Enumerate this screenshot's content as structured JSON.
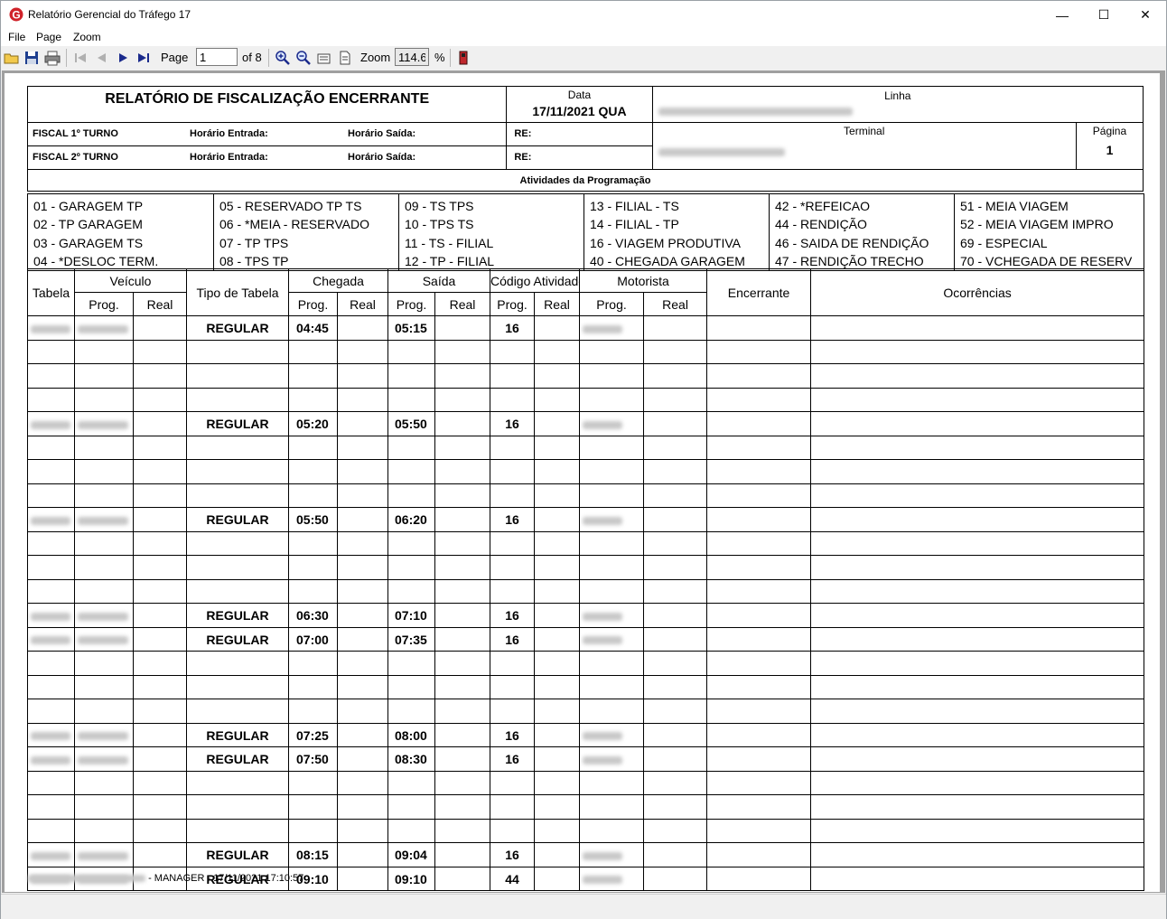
{
  "window": {
    "title": "Relatório Gerencial do Tráfego 17",
    "minimize": "—",
    "maximize": "☐",
    "close": "✕"
  },
  "menu": {
    "file": "File",
    "page": "Page",
    "zoom": "Zoom"
  },
  "toolbar": {
    "page_label": "Page",
    "page_value": "1",
    "of_pages": "of 8",
    "zoom_label": "Zoom",
    "zoom_value": "114.6",
    "percent": "%"
  },
  "report": {
    "title": "RELATÓRIO DE FISCALIZAÇÃO ENCERRANTE",
    "data_label": "Data",
    "data_value": "17/11/2021  QUA",
    "linha_label": "Linha",
    "terminal_label": "Terminal",
    "pagina_label": "Página",
    "pagina_value": "1",
    "fiscal1": "FISCAL 1º TURNO",
    "fiscal2": "FISCAL 2º TURNO",
    "horario_entrada": "Horário Entrada:",
    "horario_saida": "Horário Saída:",
    "re": "RE:",
    "atividades_title": "Atividades  da  Programação",
    "activities": [
      [
        "01 - GARAGEM TP",
        "02 - TP GARAGEM",
        "03 - GARAGEM TS",
        "04 - *DESLOC TERM."
      ],
      [
        "05 - RESERVADO TP TS",
        "06 - *MEIA - RESERVADO",
        "07 - TP TPS",
        "08 - TPS TP"
      ],
      [
        "09 - TS TPS",
        "10 - TPS TS",
        "11 - TS - FILIAL",
        "12 - TP - FILIAL"
      ],
      [
        "13 - FILIAL - TS",
        "14 - FILIAL - TP",
        "16 - VIAGEM PRODUTIVA",
        "40 - CHEGADA GARAGEM"
      ],
      [
        "42 - *REFEICAO",
        "44 - RENDIÇÃO",
        "46 - SAIDA DE RENDIÇÃO",
        "47 - RENDIÇÃO TRECHO"
      ],
      [
        "51 - MEIA VIAGEM",
        "52 - MEIA VIAGEM IMPRO",
        "69 - ESPECIAL",
        "70 - VCHEGADA DE RESERV"
      ]
    ],
    "columns": {
      "tabela": "Tabela",
      "veiculo": "Veículo",
      "prog": "Prog.",
      "real": "Real",
      "tipo_tabela": "Tipo de Tabela",
      "chegada": "Chegada",
      "saida": "Saída",
      "codigo_atividade": "Código Atividade",
      "motorista": "Motorista",
      "encerrante": "Encerrante",
      "ocorrencias": "Ocorrências"
    },
    "rows": [
      {
        "tipo": "REGULAR",
        "chegada": "04:45",
        "saida": "05:15",
        "codigo": "16"
      },
      {},
      {},
      {},
      {
        "tipo": "REGULAR",
        "chegada": "05:20",
        "saida": "05:50",
        "codigo": "16"
      },
      {},
      {},
      {},
      {
        "tipo": "REGULAR",
        "chegada": "05:50",
        "saida": "06:20",
        "codigo": "16"
      },
      {},
      {},
      {},
      {
        "tipo": "REGULAR",
        "chegada": "06:30",
        "saida": "07:10",
        "codigo": "16"
      },
      {
        "tipo": "REGULAR",
        "chegada": "07:00",
        "saida": "07:35",
        "codigo": "16"
      },
      {},
      {},
      {},
      {
        "tipo": "REGULAR",
        "chegada": "07:25",
        "saida": "08:00",
        "codigo": "16"
      },
      {
        "tipo": "REGULAR",
        "chegada": "07:50",
        "saida": "08:30",
        "codigo": "16"
      },
      {},
      {},
      {},
      {
        "tipo": "REGULAR",
        "chegada": "08:15",
        "saida": "09:04",
        "codigo": "16"
      },
      {
        "tipo": "REGULAR",
        "chegada": "09:10",
        "saida": "09:10",
        "codigo": "44"
      }
    ],
    "footer": "- MANAGER  -  17/11/2021  17:10:57"
  },
  "colors": {
    "app_icon": "#d0232a",
    "nav_arrow": "#1a2a8c",
    "viewer_bg": "#a0a0a0"
  }
}
